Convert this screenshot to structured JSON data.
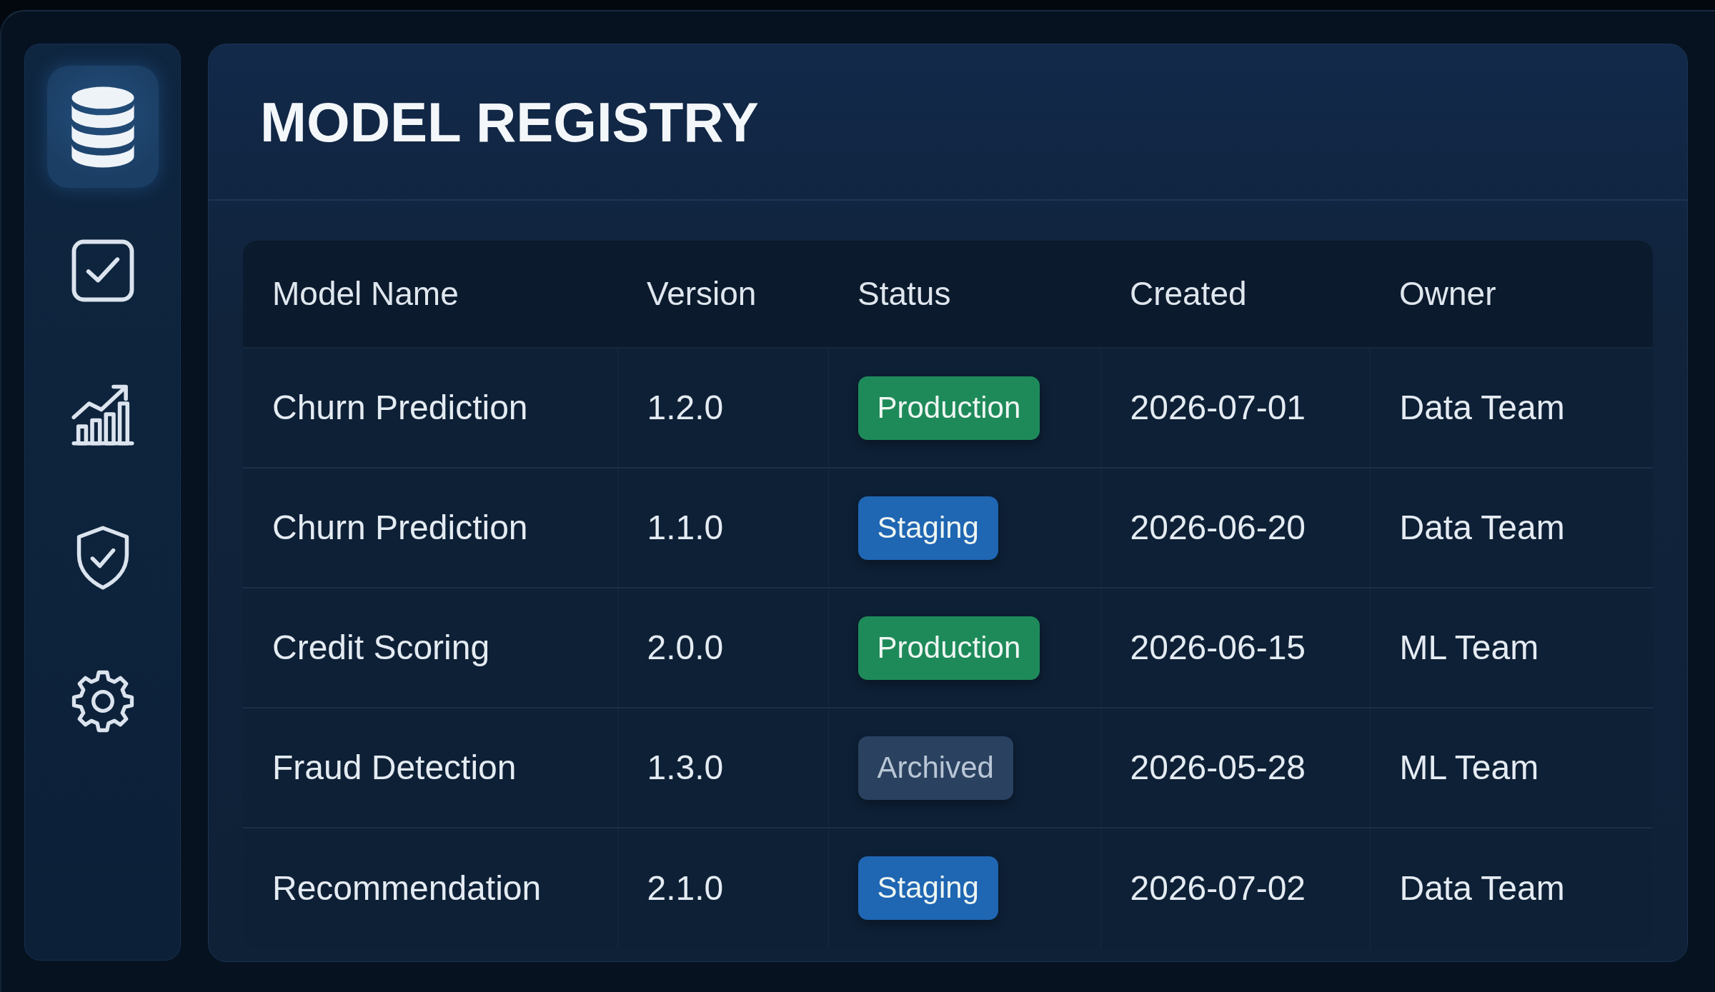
{
  "sidebar": {
    "items": [
      {
        "kind": "database",
        "selected": true
      },
      {
        "kind": "checklist",
        "selected": false
      },
      {
        "kind": "chart",
        "selected": false
      },
      {
        "kind": "shield",
        "selected": false
      },
      {
        "kind": "settings",
        "selected": false
      }
    ]
  },
  "header": {
    "title": "MODEL REGISTRY"
  },
  "table": {
    "columns": [
      "Model Name",
      "Version",
      "Status",
      "Created",
      "Owner"
    ],
    "rows": [
      {
        "model_name": "Churn Prediction",
        "version": "1.2.0",
        "status": {
          "label": "Production",
          "color": "#1e8a5a"
        },
        "created": "2026-07-01",
        "owner": "Data Team"
      },
      {
        "model_name": "Churn Prediction",
        "version": "1.1.0",
        "status": {
          "label": "Staging",
          "color": "#1f66b3"
        },
        "created": "2026-06-20",
        "owner": "Data Team"
      },
      {
        "model_name": "Credit Scoring",
        "version": "2.0.0",
        "status": {
          "label": "Production",
          "color": "#1e8a5a"
        },
        "created": "2026-06-15",
        "owner": "ML Team"
      },
      {
        "model_name": "Fraud Detection",
        "version": "1.3.0",
        "status": {
          "label": "Archived",
          "color": "#2a4260"
        },
        "created": "2026-05-28",
        "owner": "ML Team"
      },
      {
        "model_name": "Recommendation",
        "version": "2.1.0",
        "status": {
          "label": "Staging",
          "color": "#1f66b3"
        },
        "created": "2026-07-02",
        "owner": "Data Team"
      }
    ]
  }
}
